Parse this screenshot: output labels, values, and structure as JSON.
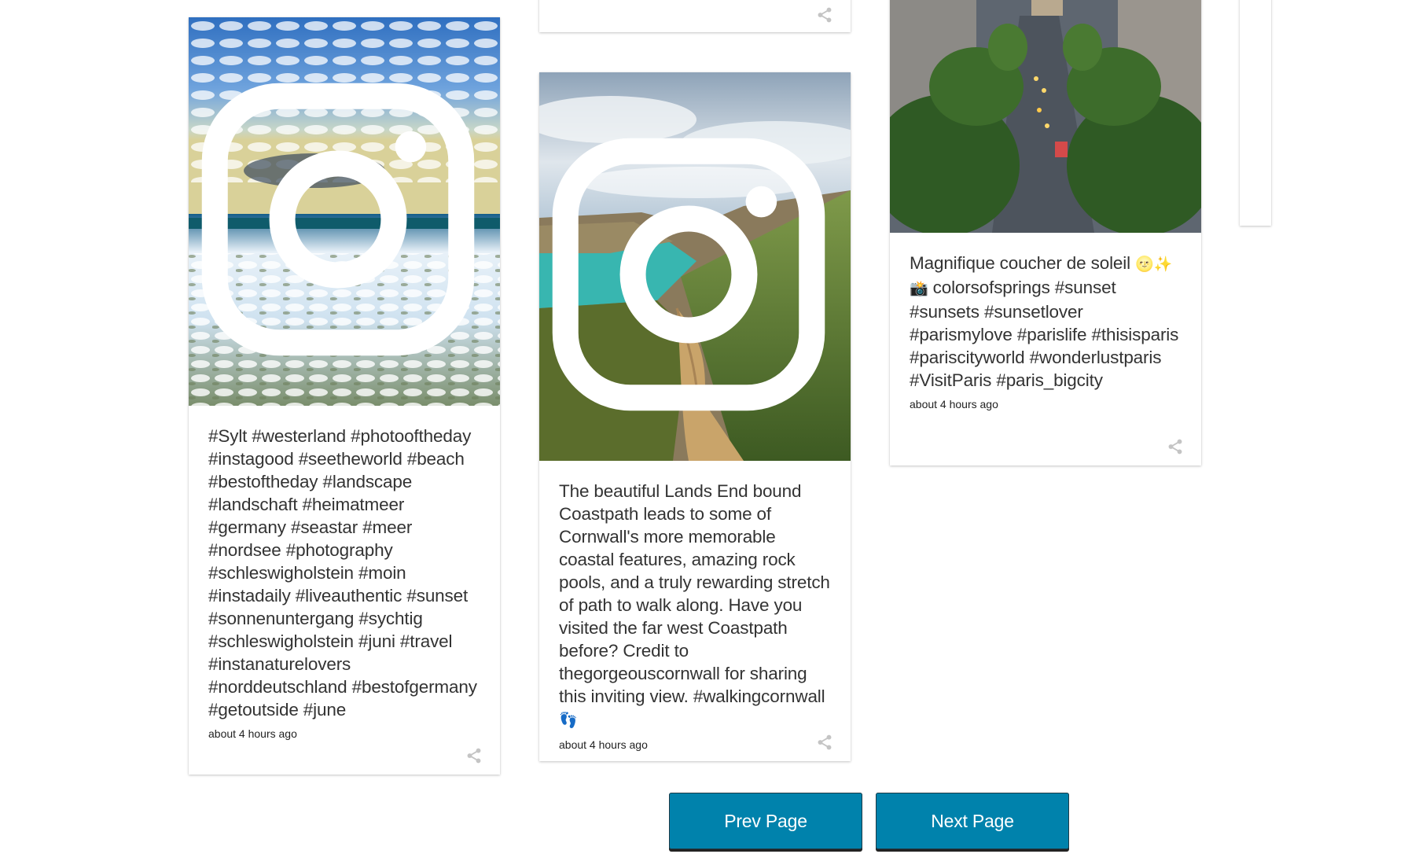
{
  "cards": [
    {
      "image_alt": "Sylt beach with clouds",
      "caption": "#Sylt #westerland #photooftheday #instagood #seetheworld #beach #bestoftheday #landscape #landschaft #heimatmeer #germany #seastar #meer #nordsee #photography #schleswigholstein #moin #instadaily #liveauthentic #sunset #sonnenuntergang #sychtig #schleswigholstein #juni #travel #instanaturelovers #norddeutschland #bestofgermany #getoutside #june",
      "timestamp": "about 4 hours ago",
      "source_icon": "instagram-icon",
      "share_icon": "share-icon"
    },
    {
      "image_alt": "Coastal path in Cornwall",
      "caption": "The beautiful Lands End bound Coastpath leads to some of Cornwall's more memorable coastal features, amazing rock pools, and a truly rewarding stretch of path to walk along. Have you visited the far west Coastpath before?  Credit to thegorgeouscornwall for sharing this inviting view. #walkingcornwall",
      "caption_emoji": "👣",
      "timestamp": "about 4 hours ago",
      "source_icon": "instagram-icon",
      "share_icon": "share-icon"
    },
    {
      "image_alt": "Paris boulevard at dusk",
      "caption": "Magnifique coucher de soleil",
      "caption_emoji": "🌝✨📸",
      "caption_rest": "colorsofsprings #sunset #sunsets #sunsetlover #parismylove #parislife #thisisparis #pariscityworld #wonderlustparis #VisitParis #paris_bigcity",
      "timestamp": "about 4 hours ago",
      "share_icon": "share-icon"
    }
  ],
  "pagination": {
    "prev_label": "Prev Page",
    "next_label": "Next Page"
  },
  "colors": {
    "button_bg": "#0082ac",
    "button_text": "#ffffff"
  }
}
